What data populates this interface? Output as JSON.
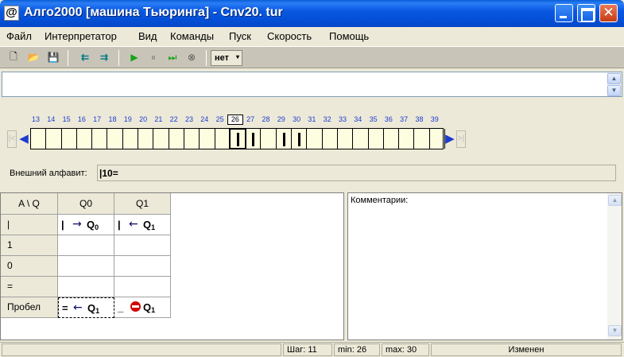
{
  "window": {
    "icon_glyph": "@",
    "title": "Алго2000 [машина Тьюринга] - Cnv20. tur",
    "minimize_icon": "minimize-icon",
    "maximize_icon": "maximize-icon",
    "close_glyph": "✕"
  },
  "menu": {
    "items": [
      "Файл",
      "Интерпретатор",
      "Вид",
      "Команды",
      "Пуск",
      "Скорость",
      "Помощь"
    ]
  },
  "toolbar": {
    "icons": [
      "new-file-icon",
      "open-folder-icon",
      "save-icon",
      "shift-left-icon",
      "shift-right-icon",
      "run-icon",
      "pause-icon",
      "step-icon",
      "stop-icon"
    ],
    "glyphs": {
      "new": "🗋",
      "open": "📂",
      "save": "💾",
      "shift_left": "⇇",
      "shift_right": "⇉",
      "run": "▶",
      "pause": "⏸",
      "step": "⏭",
      "stop": "⊗"
    },
    "speed_value": "нет",
    "speed_arrow": "▾"
  },
  "strip_scroll": {
    "up": "▲",
    "down": "▼"
  },
  "tape": {
    "numbers": [
      "13",
      "14",
      "15",
      "16",
      "17",
      "18",
      "19",
      "20",
      "21",
      "22",
      "23",
      "24",
      "25",
      "26",
      "27",
      "28",
      "29",
      "30",
      "31",
      "32",
      "33",
      "34",
      "35",
      "36",
      "37",
      "38",
      "39"
    ],
    "current_index": 13,
    "symbol_cell_indices": [
      13,
      14,
      16,
      17
    ],
    "left_stop": "|<",
    "left_arrow": "◀",
    "right_arrow": "▶",
    "right_stop": ">|"
  },
  "alphabet": {
    "label": "Внешний алфавит:",
    "value": "|10="
  },
  "program": {
    "corner": "A \\ Q",
    "states": [
      "Q0",
      "Q1"
    ],
    "rows": [
      {
        "symbol": "|",
        "cells": [
          {
            "write": "|",
            "move": "→",
            "state": "Q",
            "state_sub": "0"
          },
          {
            "write": "|",
            "move": "←",
            "state": "Q",
            "state_sub": "1"
          }
        ]
      },
      {
        "symbol": "1",
        "cells": [
          null,
          null
        ]
      },
      {
        "symbol": "0",
        "cells": [
          null,
          null
        ]
      },
      {
        "symbol": "=",
        "cells": [
          null,
          null
        ]
      },
      {
        "symbol": "Пробел",
        "cells": [
          {
            "write": "=",
            "move": "←",
            "state": "Q",
            "state_sub": "1"
          },
          {
            "write": "_",
            "stop": true,
            "state": "Q",
            "state_sub": "1"
          }
        ]
      }
    ]
  },
  "comments": {
    "label": "Комментарии:"
  },
  "status": {
    "step": "Шаг:  11",
    "min": "min: 26",
    "max": "max: 30",
    "state": "Изменен"
  }
}
